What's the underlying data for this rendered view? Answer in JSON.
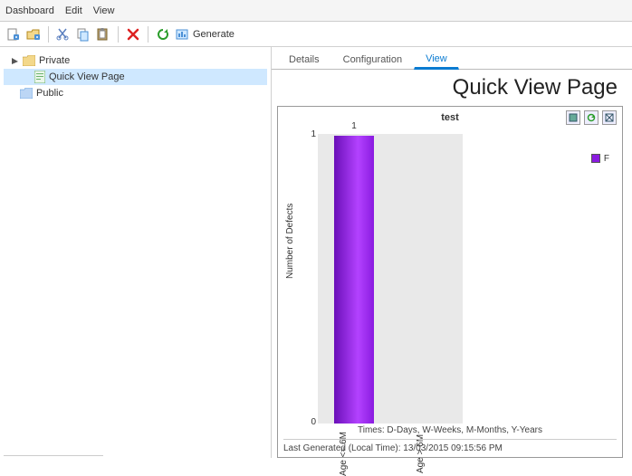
{
  "menubar": {
    "items": [
      "Dashboard",
      "Edit",
      "View"
    ]
  },
  "toolbar": {
    "generate_label": "Generate"
  },
  "tree": {
    "private_label": "Private",
    "public_label": "Public",
    "page_label": "Quick View Page"
  },
  "tabs": {
    "details": "Details",
    "configuration": "Configuration",
    "view": "View"
  },
  "page_title": "Quick View Page",
  "chart_data": {
    "type": "bar",
    "title": "test",
    "categories": [
      "Age <= 6M",
      "Age > 6M"
    ],
    "values": [
      1,
      0
    ],
    "series": [
      {
        "name": "F",
        "values": [
          1,
          0
        ]
      }
    ],
    "ylabel": "Number of Defects",
    "xlabel": "",
    "ylim": [
      0,
      1
    ],
    "caption": "Times: D-Days, W-Weeks, M-Months, Y-Years",
    "footer": "Last Generated (Local Time): 13/03/2015 09:15:56 PM"
  }
}
